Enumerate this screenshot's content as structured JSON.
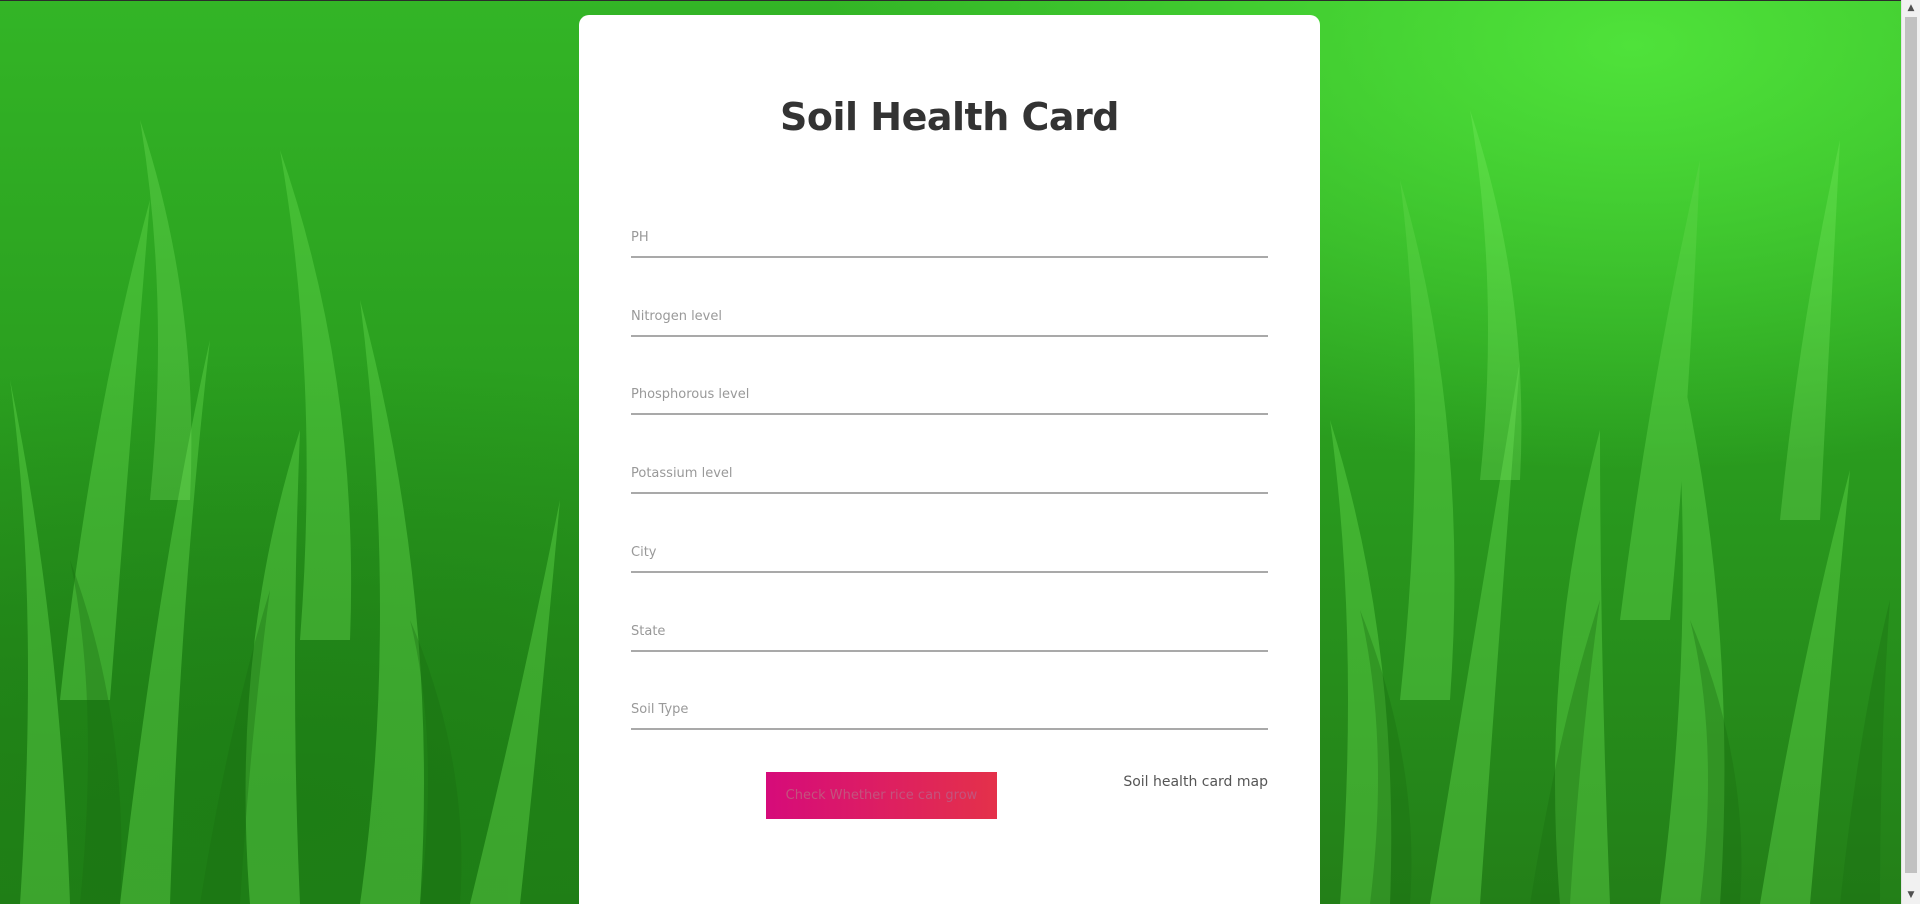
{
  "card": {
    "title": "Soil Health Card"
  },
  "form": {
    "fields": [
      {
        "placeholder": "PH",
        "value": ""
      },
      {
        "placeholder": "Nitrogen level",
        "value": ""
      },
      {
        "placeholder": "Phosphorous level",
        "value": ""
      },
      {
        "placeholder": "Potassium level",
        "value": ""
      },
      {
        "placeholder": "City",
        "value": ""
      },
      {
        "placeholder": "State",
        "value": ""
      },
      {
        "placeholder": "Soil Type",
        "value": ""
      }
    ],
    "submit_label": "Check Whether rice can grow",
    "map_link": "Soil health card map"
  },
  "colors": {
    "background": "#2a9e1f",
    "card": "#ffffff",
    "button_start": "#d60b7a",
    "button_end": "#e4314a",
    "title": "#333333"
  },
  "icons": {
    "scroll_up": "scroll-up-arrow-icon",
    "scroll_down": "scroll-down-arrow-icon"
  }
}
